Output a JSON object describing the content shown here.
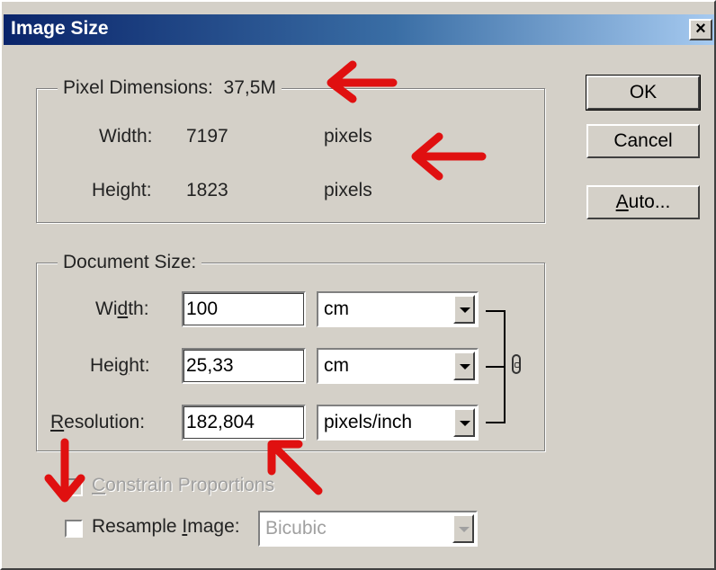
{
  "window": {
    "title": "Image Size",
    "close_label": "×"
  },
  "pixel_dimensions": {
    "legend": "Pixel Dimensions:  37,5M",
    "width_label": "Width:",
    "width_value": "7197",
    "width_unit": "pixels",
    "height_label": "Height:",
    "height_value": "1823",
    "height_unit": "pixels"
  },
  "document_size": {
    "legend": "Document Size:",
    "width_label_pre": "Wi",
    "width_label_u": "d",
    "width_label_post": "th:",
    "width_value": "100",
    "width_unit": "cm",
    "height_label_pre": "Hei",
    "height_label_u": "g",
    "height_label_post": "ht:",
    "height_value": "25,33",
    "height_unit": "cm",
    "resolution_label_u": "R",
    "resolution_label_post": "esolution:",
    "resolution_value": "182,804",
    "resolution_unit": "pixels/inch"
  },
  "options": {
    "constrain_u": "C",
    "constrain_post": "onstrain Proportions",
    "resample_pre": "Resample ",
    "resample_u": "I",
    "resample_post": "mage:",
    "resample_value": "Bicubic"
  },
  "buttons": {
    "ok": "OK",
    "cancel": "Cancel",
    "auto_u": "A",
    "auto_post": "uto..."
  },
  "colors": {
    "annotation_arrow": "#e01010",
    "title_start": "#0a246a",
    "title_end": "#a6caf0"
  }
}
